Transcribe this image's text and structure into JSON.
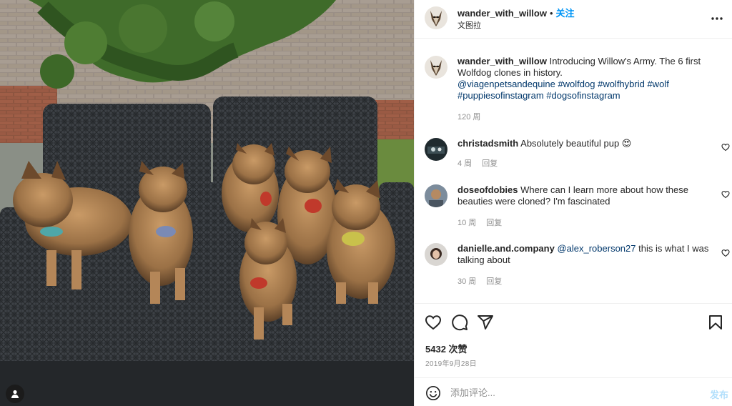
{
  "post": {
    "author": "wander_with_willow",
    "follow_label": "关注",
    "location": "文图拉",
    "more_icon": "more-horizontal-icon"
  },
  "caption": {
    "user": "wander_with_willow",
    "text_plain": "Introducing Willow's Army. The 6 first Wolfdog clones in history.",
    "mention": "@viagenpetsandequine",
    "hashtags": "#wolfdog #wolfhybrid #wolf #puppiesofinstagram #dogsofinstagram",
    "time": "120 周"
  },
  "comments": [
    {
      "user": "christadsmith",
      "text": "Absolutely beautiful pup 😍",
      "time": "4 周",
      "reply": "回复"
    },
    {
      "user": "doseofdobies",
      "text": "Where can I learn more about how these beauties were cloned? I'm fascinated",
      "time": "10 周",
      "reply": "回复"
    },
    {
      "user": "danielle.and.company",
      "mention": "@alex_roberson27",
      "text": "this is what I was talking about",
      "time": "30 周",
      "reply": "回复"
    }
  ],
  "actions": {
    "icons": [
      "heart-icon",
      "comment-icon",
      "share-icon",
      "bookmark-icon"
    ],
    "likes": "5432 次赞",
    "date": "2019年9月28日"
  },
  "add_comment": {
    "placeholder": "添加评论...",
    "post_label": "发布",
    "emoji_icon": "smiley-icon"
  },
  "colors": {
    "follow": "#0095f6",
    "link": "#00376b",
    "muted": "#8e8e8e",
    "post_disabled": "#b2dffc"
  },
  "photo": {
    "description_icon": "user-tag-icon"
  }
}
